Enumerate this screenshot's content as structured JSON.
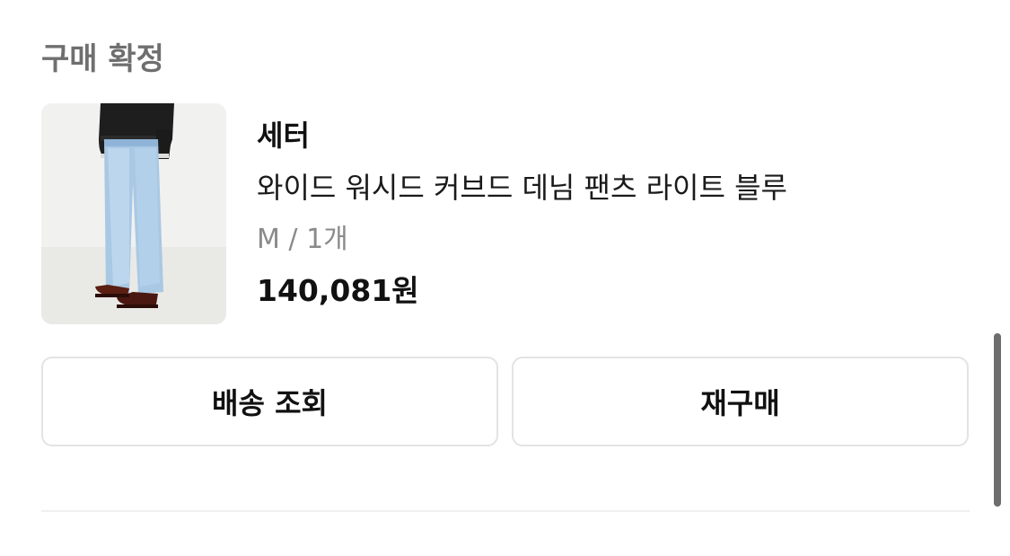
{
  "order": {
    "status": "구매 확정"
  },
  "product": {
    "brand": "세터",
    "name": "와이드 워시드 커브드 데님 팬츠 라이트 블루",
    "option": "M / 1개",
    "price": "140,081원",
    "image_icon": "denim-pants-product-photo"
  },
  "actions": {
    "track_label": "배송 조회",
    "rebuy_label": "재구매"
  },
  "colors": {
    "status_text": "#6f6f6f",
    "option_text": "#8a8a8a",
    "button_border": "#e3e3e3",
    "scrollbar": "#6e6e6e"
  }
}
